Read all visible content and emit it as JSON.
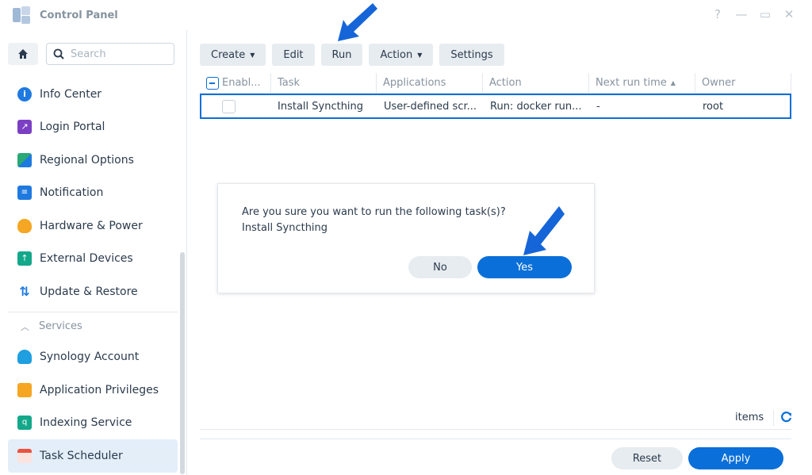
{
  "window": {
    "title": "Control Panel",
    "controls": [
      "?",
      "—",
      "▭",
      "✕"
    ]
  },
  "sidebar": {
    "search_placeholder": "Search",
    "items": [
      {
        "label": "Info Center",
        "icon": "info-icon",
        "color": "#1f7ae0"
      },
      {
        "label": "Login Portal",
        "icon": "login-portal-icon",
        "color": "#7b3fc4"
      },
      {
        "label": "Regional Options",
        "icon": "regional-options-icon",
        "color": "#2aa876"
      },
      {
        "label": "Notification",
        "icon": "notification-icon",
        "color": "#1f7ae0"
      },
      {
        "label": "Hardware & Power",
        "icon": "bulb-icon",
        "color": "#f5a623"
      },
      {
        "label": "External Devices",
        "icon": "external-devices-icon",
        "color": "#14a88a"
      },
      {
        "label": "Update & Restore",
        "icon": "update-restore-icon",
        "color": "#1f7ae0"
      }
    ],
    "section": "Services",
    "service_items": [
      {
        "label": "Synology Account",
        "icon": "account-icon",
        "color": "#1f9fe0"
      },
      {
        "label": "Application Privileges",
        "icon": "lock-icon",
        "color": "#f5a623"
      },
      {
        "label": "Indexing Service",
        "icon": "indexing-icon",
        "color": "#14a88a"
      },
      {
        "label": "Task Scheduler",
        "icon": "calendar-icon",
        "color": "#e8543f"
      }
    ]
  },
  "toolbar": {
    "create": "Create",
    "edit": "Edit",
    "run": "Run",
    "action": "Action",
    "settings": "Settings"
  },
  "table": {
    "columns": [
      "Enabl...",
      "Task",
      "Applications",
      "Action",
      "Next run time",
      "Owner"
    ],
    "sort_indicator": "▲",
    "rows": [
      {
        "task": "Install Syncthing",
        "application": "User-defined scr...",
        "action": "Run: docker run...",
        "next_run": "-",
        "owner": "root"
      }
    ]
  },
  "dialog": {
    "line1": "Are you sure you want to run the following task(s)?",
    "line2": "Install Syncthing",
    "no": "No",
    "yes": "Yes"
  },
  "footer": {
    "items_label": "items",
    "reset": "Reset",
    "apply": "Apply"
  },
  "colors": {
    "accent": "#0a6fd8",
    "arrow": "#1565d8"
  }
}
